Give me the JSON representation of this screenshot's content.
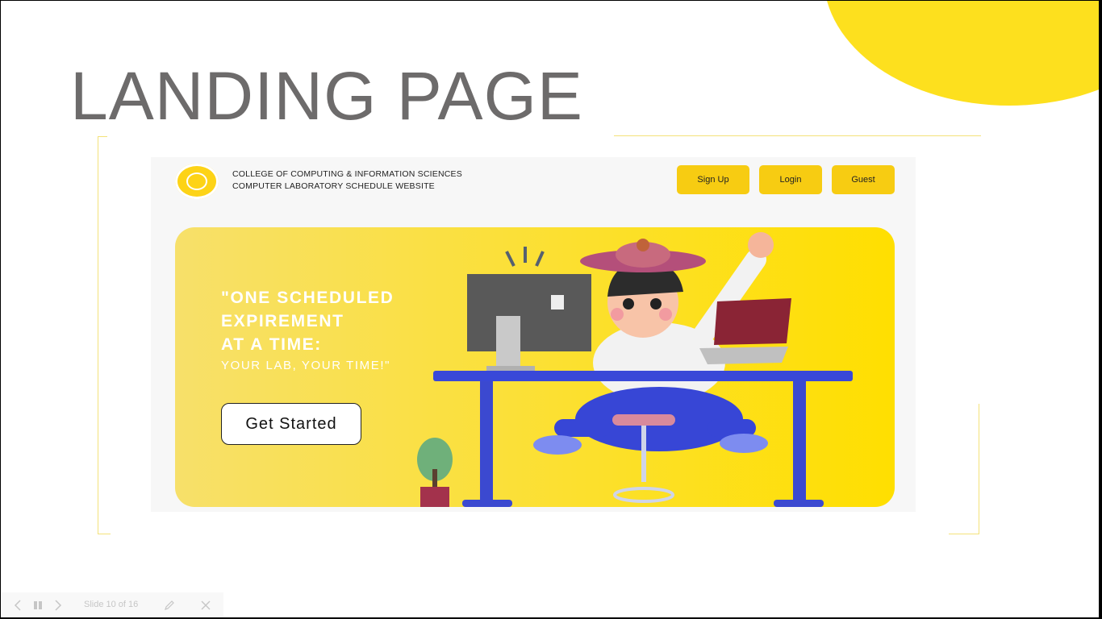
{
  "slide": {
    "title": "LANDING PAGE"
  },
  "site": {
    "college_name": "COLLEGE OF COMPUTING & INFORMATION SCIENCES",
    "site_subtitle": "COMPUTER LABORATORY SCHEDULE WEBSITE",
    "nav": {
      "signup_label": "Sign Up",
      "login_label": "Login",
      "guest_label": "Guest"
    },
    "hero": {
      "line1": "\"ONE SCHEDULED",
      "line2": "EXPIREMENT",
      "line3": "AT A TIME:",
      "line4": "YOUR LAB, YOUR TIME!\"",
      "cta_label": "Get Started"
    },
    "colors": {
      "accent": "#f7cc12",
      "hero_bg": "#ffdf00",
      "title_gray": "#6d6b6b"
    }
  },
  "controls": {
    "slide_counter": "Slide 10 of 16",
    "icons": [
      "chevron-left-icon",
      "pause-icon",
      "chevron-right-icon",
      "pen-icon",
      "close-icon"
    ]
  }
}
